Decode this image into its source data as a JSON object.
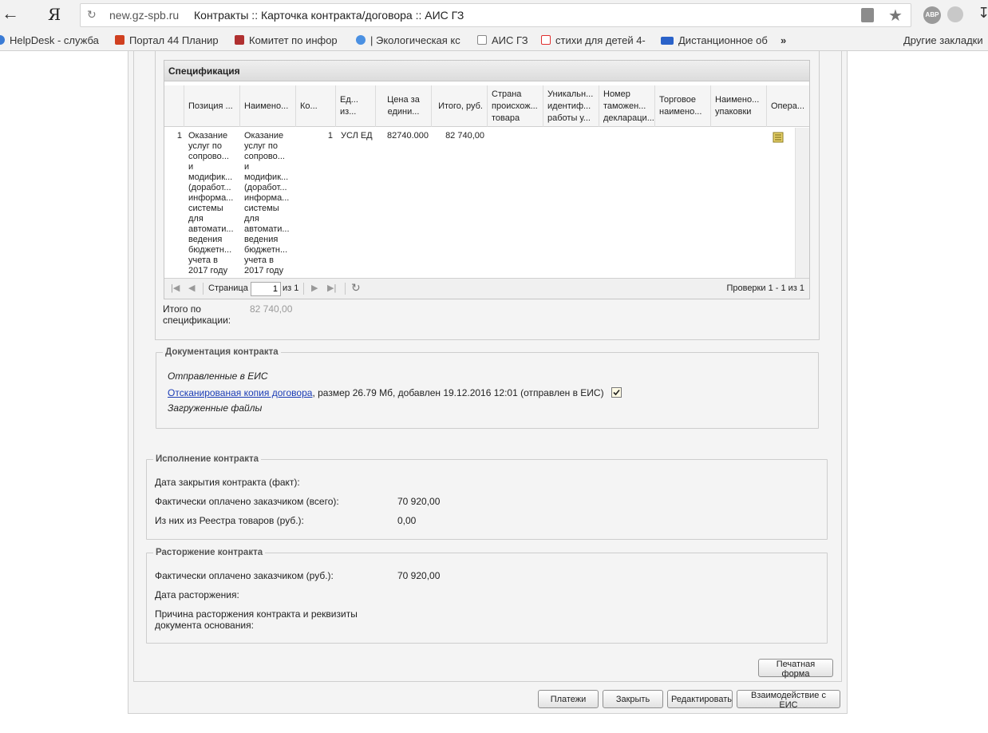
{
  "browser": {
    "url_domain": "new.gz-spb.ru",
    "page_title": "Контракты :: Карточка контракта/договора :: АИС ГЗ",
    "yandex_logo": "Я",
    "abp_label": "ABP"
  },
  "bookmarks": [
    {
      "label": "HelpDesk - служба",
      "color": "#3a7bd5"
    },
    {
      "label": "Портал 44 Планир",
      "color": "#d04020"
    },
    {
      "label": "Комитет по инфор",
      "color": "#b03030"
    },
    {
      "label": "| Экологическая кс",
      "color": "#4a90e2"
    },
    {
      "label": "АИС ГЗ",
      "color": "#888888"
    },
    {
      "label": "стихи для детей 4-",
      "color": "#e03030"
    },
    {
      "label": "Дистанционное об",
      "color": "#2a62c9"
    }
  ],
  "bookmarks_more": "»",
  "bookmarks_other": "Другие закладки",
  "spec": {
    "title": "Спецификация",
    "columns": [
      "Позиция ...",
      "Наимено...",
      "Ко...",
      "Ед... из...",
      "Цена за едини...",
      "Итого, руб.",
      "Страна происхож... товара",
      "Уникальн... идентиф... работы у...",
      "Номер таможен... деклараци...",
      "Торговое наимено...",
      "Наимено... упаковки",
      "Опера..."
    ],
    "row": {
      "num": "1",
      "position": "Оказание услуг по сопрово... и модифик... (доработ... информа... системы для автомати... ведения бюджетн... учета в 2017 году",
      "name": "Оказание услуг по сопрово... и модифик... (доработ... информа... системы для автомати... ведения бюджетн... учета в 2017 году",
      "qty": "1",
      "unit": "УСЛ ЕД",
      "price": "82740.000",
      "total": "82 740,00"
    },
    "pager": {
      "page_label": "Страница",
      "page_value": "1",
      "of_label": "из 1",
      "records": "Проверки 1 - 1 из 1"
    },
    "total_label": "Итого по спецификации:",
    "total_value": "82 740,00"
  },
  "docs": {
    "legend": "Документация контракта",
    "sent_label": "Отправленные в ЕИС",
    "link_text": "Отсканированая копия договора",
    "link_meta": ", размер 26.79 Мб, добавлен 19.12.2016 12:01 (отправлен в ЕИС)",
    "uploaded_label": "Загруженные файлы"
  },
  "execution": {
    "legend": "Исполнение контракта",
    "close_date_label": "Дата закрытия контракта (факт):",
    "paid_total_label": "Фактически оплачено заказчиком (всего):",
    "paid_total_value": "70 920,00",
    "registry_label": "Из них из Реестра товаров (руб.):",
    "registry_value": "0,00"
  },
  "termination": {
    "legend": "Расторжение контракта",
    "paid_label": "Фактически оплачено заказчиком (руб.):",
    "paid_value": "70 920,00",
    "date_label": "Дата расторжения:",
    "reason_label": "Причина расторжения контракта и реквизиты документа основания:"
  },
  "buttons": {
    "print": "Печатная форма",
    "payments": "Платежи",
    "close": "Закрыть",
    "edit": "Редактировать",
    "eis": "Взаимодействие с ЕИС"
  }
}
